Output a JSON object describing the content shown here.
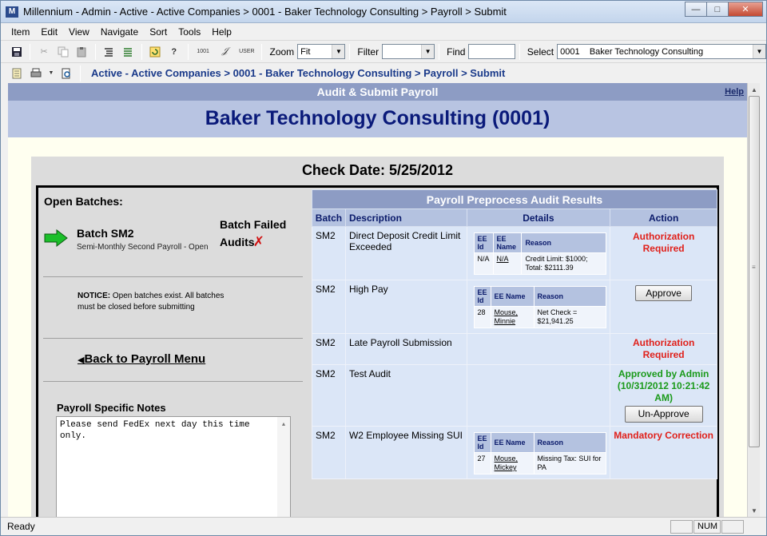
{
  "window": {
    "title": "Millennium - Admin - Active - Active Companies > 0001 - Baker Technology Consulting > Payroll > Submit",
    "icon_letter": "M",
    "minimize": "—",
    "maximize": "□",
    "close": "✕"
  },
  "menu": [
    "Item",
    "Edit",
    "View",
    "Navigate",
    "Sort",
    "Tools",
    "Help"
  ],
  "toolbar": {
    "zoom_label": "Zoom",
    "zoom_value": "Fit",
    "filter_label": "Filter",
    "filter_value": "",
    "find_label": "Find",
    "find_value": "",
    "select_label": "Select",
    "select_value": "0001    Baker Technology Consulting",
    "icon_1001": "1001",
    "icon_user": "USER"
  },
  "breadcrumb": "Active - Active Companies > 0001 - Baker Technology Consulting > Payroll > Submit",
  "page": {
    "header": "Audit & Submit Payroll",
    "help": "Help",
    "company": "Baker Technology Consulting (0001)",
    "check_date": "Check Date: 5/25/2012"
  },
  "left": {
    "open_batches": "Open Batches:",
    "batch_name": "Batch SM2",
    "batch_sub": "Semi-Monthly Second Payroll - Open",
    "batch_failed": "Batch Failed",
    "audits": "Audits",
    "notice_bold": "NOTICE:",
    "notice_text": " Open batches exist. All batches must be closed before submitting",
    "back": "Back to Payroll Menu",
    "notes_title": "Payroll Specific Notes",
    "notes_text": "Please send FedEx next day this time only."
  },
  "audit": {
    "title": "Payroll Preprocess Audit Results",
    "columns": [
      "Batch",
      "Description",
      "Details",
      "Action"
    ],
    "mini_headers": [
      "EE Id",
      "EE Name",
      "Reason"
    ],
    "rows": [
      {
        "batch": "SM2",
        "description": "Direct Deposit Credit Limit Exceeded",
        "ee_id": "N/A",
        "ee_name": "N/A",
        "reason": "Credit Limit: $1000; Total: $2111.39",
        "action": "Authorization Required"
      },
      {
        "batch": "SM2",
        "description": "High Pay",
        "ee_id": "28",
        "ee_name": "Mouse, Minnie",
        "reason": "Net Check = $21,941.25",
        "action": "Approve"
      },
      {
        "batch": "SM2",
        "description": "Late Payroll Submission",
        "action": "Authorization Required"
      },
      {
        "batch": "SM2",
        "description": "Test Audit",
        "action": "Approved by Admin (10/31/2012 10:21:42 AM)",
        "button": "Un-Approve"
      },
      {
        "batch": "SM2",
        "description": "W2 Employee Missing SUI",
        "ee_id": "27",
        "ee_name": "Mouse, Mickey",
        "reason": "Missing Tax: SUI for PA",
        "action": "Mandatory Correction"
      }
    ]
  },
  "status": {
    "text": "Ready",
    "num": "NUM"
  }
}
